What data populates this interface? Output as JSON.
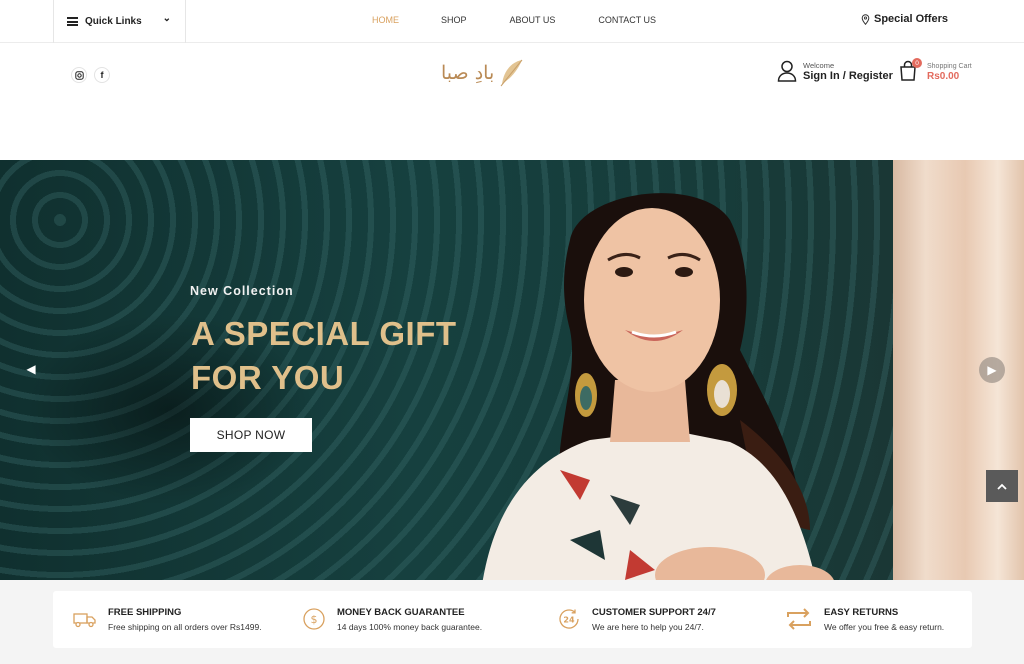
{
  "topbar": {
    "quick_links": "Quick Links",
    "nav": [
      {
        "label": "HOME",
        "active": true
      },
      {
        "label": "SHOP",
        "active": false
      },
      {
        "label": "ABOUT US",
        "active": false
      },
      {
        "label": "CONTACT US",
        "active": false
      }
    ],
    "special_offers": "Special Offers"
  },
  "header": {
    "logo_text": "بادِ صبا",
    "welcome": "Welcome",
    "signin": "Sign In / Register",
    "cart_label": "Shopping Cart",
    "cart_count": "0",
    "cart_amount": "Rs0.00"
  },
  "hero": {
    "eyebrow": "New Collection",
    "headline_line1": "A SPECIAL GIFT",
    "headline_line2": "FOR YOU",
    "cta": "SHOP NOW"
  },
  "features": [
    {
      "icon": "truck-icon",
      "title": "FREE SHIPPING",
      "desc": "Free shipping on all orders over Rs1499."
    },
    {
      "icon": "dollar-circle-icon",
      "title": "MONEY BACK GUARANTEE",
      "desc": "14 days 100% money back guarantee."
    },
    {
      "icon": "support-24-icon",
      "title": "CUSTOMER SUPPORT 24/7",
      "desc": "We are here to help you 24/7."
    },
    {
      "icon": "returns-icon",
      "title": "EASY RETURNS",
      "desc": "We offer you free & easy return."
    }
  ],
  "colors": {
    "accent": "#d9a15f",
    "headline": "#e0c08b",
    "cart_red": "#e36a5d"
  }
}
